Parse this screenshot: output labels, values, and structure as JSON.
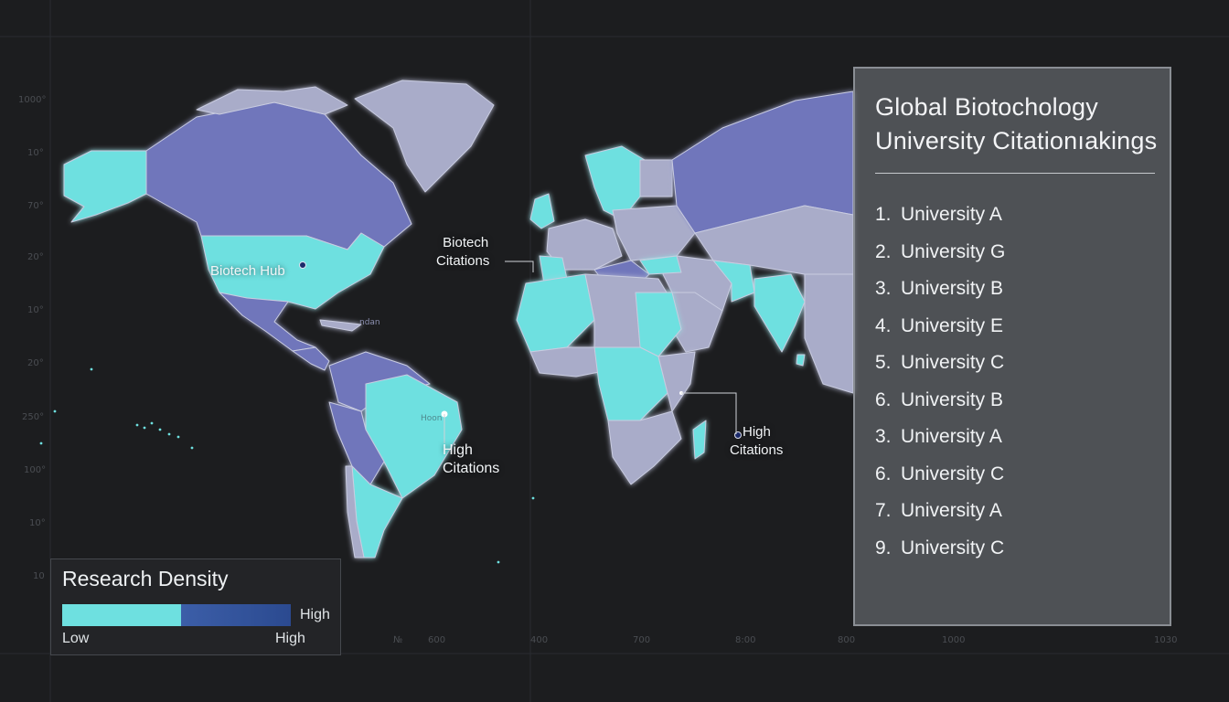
{
  "colors": {
    "background": "#1c1d1f",
    "high_density": "#6ee0e0",
    "mid_density": "#7076bb",
    "low_density": "#a9acc9",
    "ocean": "#1c1d1f"
  },
  "axis_left_labels": [
    "1000°",
    "10°",
    "70°",
    "20°",
    "10°",
    "20°",
    "250°",
    "100°",
    "10°",
    "10"
  ],
  "axis_bottom_labels": [
    "№",
    "600",
    "400",
    "700",
    "8:00",
    "800",
    "1000",
    "1030"
  ],
  "map_labels": {
    "biotech_hub": "Biotech Hub",
    "biotech_citations_line1": "Biotech",
    "biotech_citations_line2": "Citations",
    "high_citations_sa_line1": "High",
    "high_citations_sa_line2": "Citations",
    "high_citations_africa_line1": "High",
    "high_citations_africa_line2": "Citations",
    "hoon": "Hoon",
    "ndan": "ndan"
  },
  "ranking": {
    "title": "Global Biotochology University Citationıakings",
    "items": [
      {
        "num": "1.",
        "name": "University A"
      },
      {
        "num": "2.",
        "name": "University G"
      },
      {
        "num": "3.",
        "name": "University B"
      },
      {
        "num": "4.",
        "name": "University E"
      },
      {
        "num": "5.",
        "name": "University C"
      },
      {
        "num": "6.",
        "name": "University B"
      },
      {
        "num": "3.",
        "name": "University A"
      },
      {
        "num": "6.",
        "name": "University C"
      },
      {
        "num": "7.",
        "name": "University A"
      },
      {
        "num": "9.",
        "name": "University C"
      }
    ]
  },
  "legend": {
    "title": "Research Density",
    "high_right": "High",
    "low": "Low",
    "high": "High"
  }
}
